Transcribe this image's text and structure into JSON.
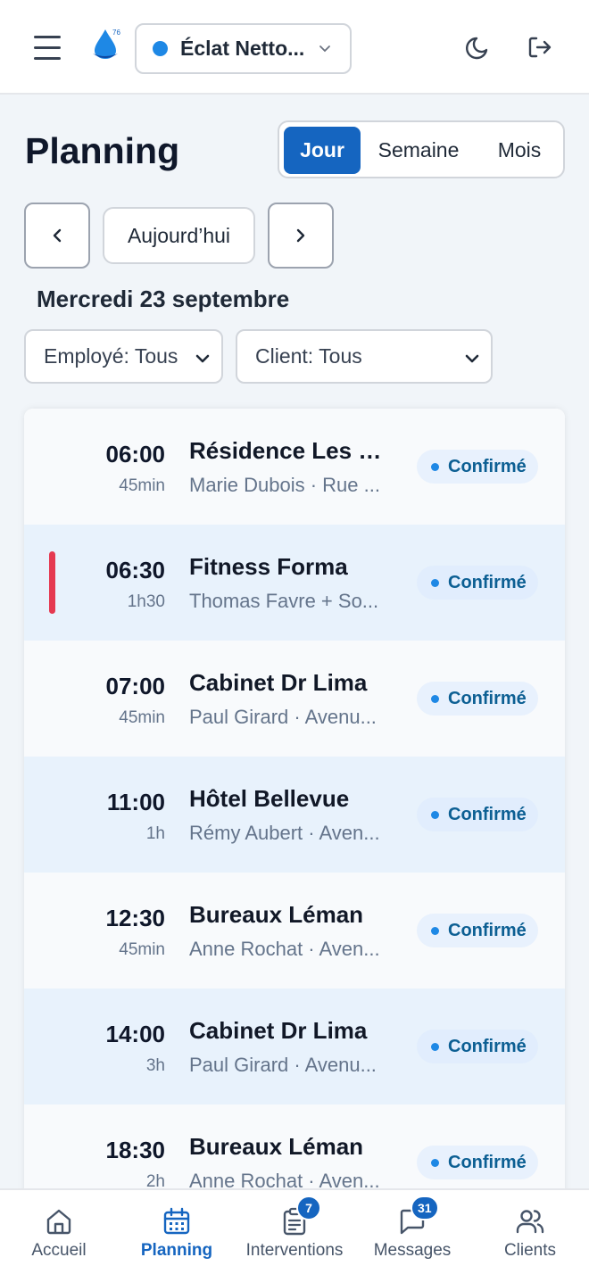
{
  "header": {
    "org_name": "Éclat Netto...",
    "logo_badge": "76"
  },
  "page": {
    "title": "Planning",
    "views": [
      "Jour",
      "Semaine",
      "Mois"
    ],
    "active_view": "Jour",
    "today_label": "Aujourd’hui",
    "date_label": "Mercredi 23 septembre"
  },
  "filters": {
    "employee": "Employé: Tous",
    "client": "Client: Tous"
  },
  "appointments": [
    {
      "time": "06:00",
      "duration": "45min",
      "title": "Résidence Les Ti...",
      "subtitle": "Marie Dubois · Rue ...",
      "status": "Confirmé",
      "urgent": false
    },
    {
      "time": "06:30",
      "duration": "1h30",
      "title": "Fitness Forma",
      "subtitle": "Thomas Favre + So...",
      "status": "Confirmé",
      "urgent": true
    },
    {
      "time": "07:00",
      "duration": "45min",
      "title": "Cabinet Dr Lima",
      "subtitle": "Paul Girard · Avenu...",
      "status": "Confirmé",
      "urgent": false
    },
    {
      "time": "11:00",
      "duration": "1h",
      "title": "Hôtel Bellevue",
      "subtitle": "Rémy Aubert · Aven...",
      "status": "Confirmé",
      "urgent": false
    },
    {
      "time": "12:30",
      "duration": "45min",
      "title": "Bureaux Léman",
      "subtitle": "Anne Rochat · Aven...",
      "status": "Confirmé",
      "urgent": false
    },
    {
      "time": "14:00",
      "duration": "3h",
      "title": "Cabinet Dr Lima",
      "subtitle": "Paul Girard · Avenu...",
      "status": "Confirmé",
      "urgent": false
    },
    {
      "time": "18:30",
      "duration": "2h",
      "title": "Bureaux Léman",
      "subtitle": "Anne Rochat · Aven...",
      "status": "Confirmé",
      "urgent": false
    }
  ],
  "bottom_nav": [
    {
      "label": "Accueil",
      "icon": "home-icon",
      "badge": null
    },
    {
      "label": "Planning",
      "icon": "calendar-icon",
      "badge": null,
      "active": true
    },
    {
      "label": "Interventions",
      "icon": "clipboard-icon",
      "badge": "7"
    },
    {
      "label": "Messages",
      "icon": "message-icon",
      "badge": "31"
    },
    {
      "label": "Clients",
      "icon": "users-icon",
      "badge": null
    }
  ],
  "colors": {
    "primary": "#1565c0",
    "accent_dot": "#1e88e5",
    "urgent": "#e53950",
    "status_text": "#0c5f93",
    "row_alt": "#e8f2fc"
  }
}
